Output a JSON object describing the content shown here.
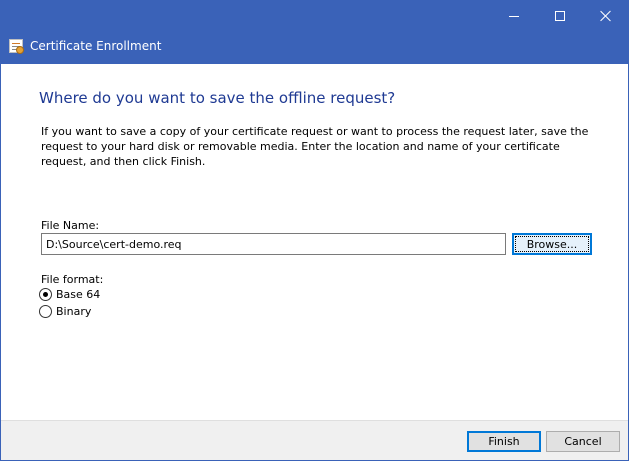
{
  "window": {
    "title": "Certificate Enrollment",
    "accent_color": "#3a62b8",
    "icon": "certificate-icon"
  },
  "caption_buttons": {
    "minimize_icon": "minimize-icon",
    "maximize_icon": "maximize-icon",
    "close_icon": "close-icon"
  },
  "page": {
    "heading": "Where do you want to save the offline request?",
    "description": "If you want to save a copy of your certificate request or want to process the request later, save the request to your hard disk or removable media. Enter the location and name of your certificate request, and then click Finish."
  },
  "file": {
    "label": "File Name:",
    "value": "D:\\Source\\cert-demo.req",
    "browse_label": "Browse..."
  },
  "format": {
    "label": "File format:",
    "options": [
      {
        "label": "Base 64",
        "selected": true
      },
      {
        "label": "Binary",
        "selected": false
      }
    ]
  },
  "footer": {
    "finish_label": "Finish",
    "cancel_label": "Cancel"
  }
}
